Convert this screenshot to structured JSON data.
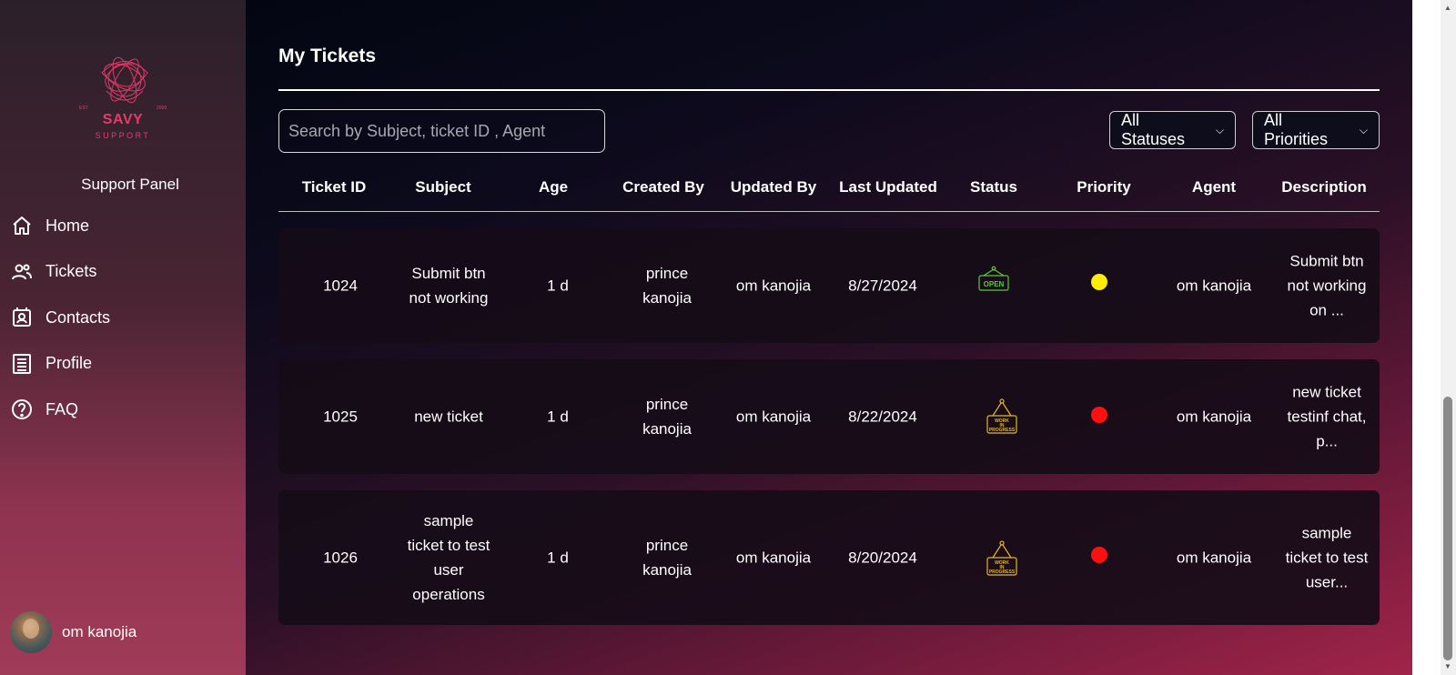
{
  "sidebar": {
    "logo": {
      "name": "SAVY",
      "tagline": "SUPPORT",
      "est": "EST",
      "year": "2009"
    },
    "panel_title": "Support Panel",
    "items": [
      {
        "label": "Home",
        "icon": "home-icon"
      },
      {
        "label": "Tickets",
        "icon": "users-icon"
      },
      {
        "label": "Contacts",
        "icon": "contacts-icon"
      },
      {
        "label": "Profile",
        "icon": "profile-icon"
      },
      {
        "label": "FAQ",
        "icon": "help-icon"
      }
    ],
    "user": {
      "name": "om kanojia"
    }
  },
  "main": {
    "title": "My Tickets",
    "search": {
      "placeholder": "Search by Subject, ticket ID , Agent",
      "value": ""
    },
    "filters": {
      "status": "All Statuses",
      "priority": "All Priorities"
    },
    "columns": [
      "Ticket ID",
      "Subject",
      "Age",
      "Created By",
      "Updated By",
      "Last Updated",
      "Status",
      "Priority",
      "Agent",
      "Description"
    ],
    "rows": [
      {
        "id": "1024",
        "subject": "Submit btn\nnot working",
        "age": "1 d",
        "created_by": "prince\nkanojia",
        "updated_by": "om kanojia",
        "last_updated": "8/27/2024",
        "status": "OPEN",
        "status_icon": "open-sign-icon",
        "priority_color": "#ffee00",
        "agent": "om kanojia",
        "description": "Submit btn\nnot working\non ..."
      },
      {
        "id": "1025",
        "subject": "new ticket",
        "age": "1 d",
        "created_by": "prince\nkanojia",
        "updated_by": "om kanojia",
        "last_updated": "8/22/2024",
        "status": "WORK IN PROGRESS",
        "status_icon": "in-progress-sign-icon",
        "priority_color": "#ff1010",
        "agent": "om kanojia",
        "description": "new ticket\ntestinf chat,\np..."
      },
      {
        "id": "1026",
        "subject": "sample\nticket to test\nuser\noperations",
        "age": "1 d",
        "created_by": "prince\nkanojia",
        "updated_by": "om kanojia",
        "last_updated": "8/20/2024",
        "status": "WORK IN PROGRESS",
        "status_icon": "in-progress-sign-icon",
        "priority_color": "#ff1010",
        "agent": "om kanojia",
        "description": "sample\nticket to test\nuser..."
      }
    ]
  },
  "colors": {
    "accent": "#e63b6a",
    "open": "#5ec93a",
    "in_progress": "#e0b820"
  }
}
